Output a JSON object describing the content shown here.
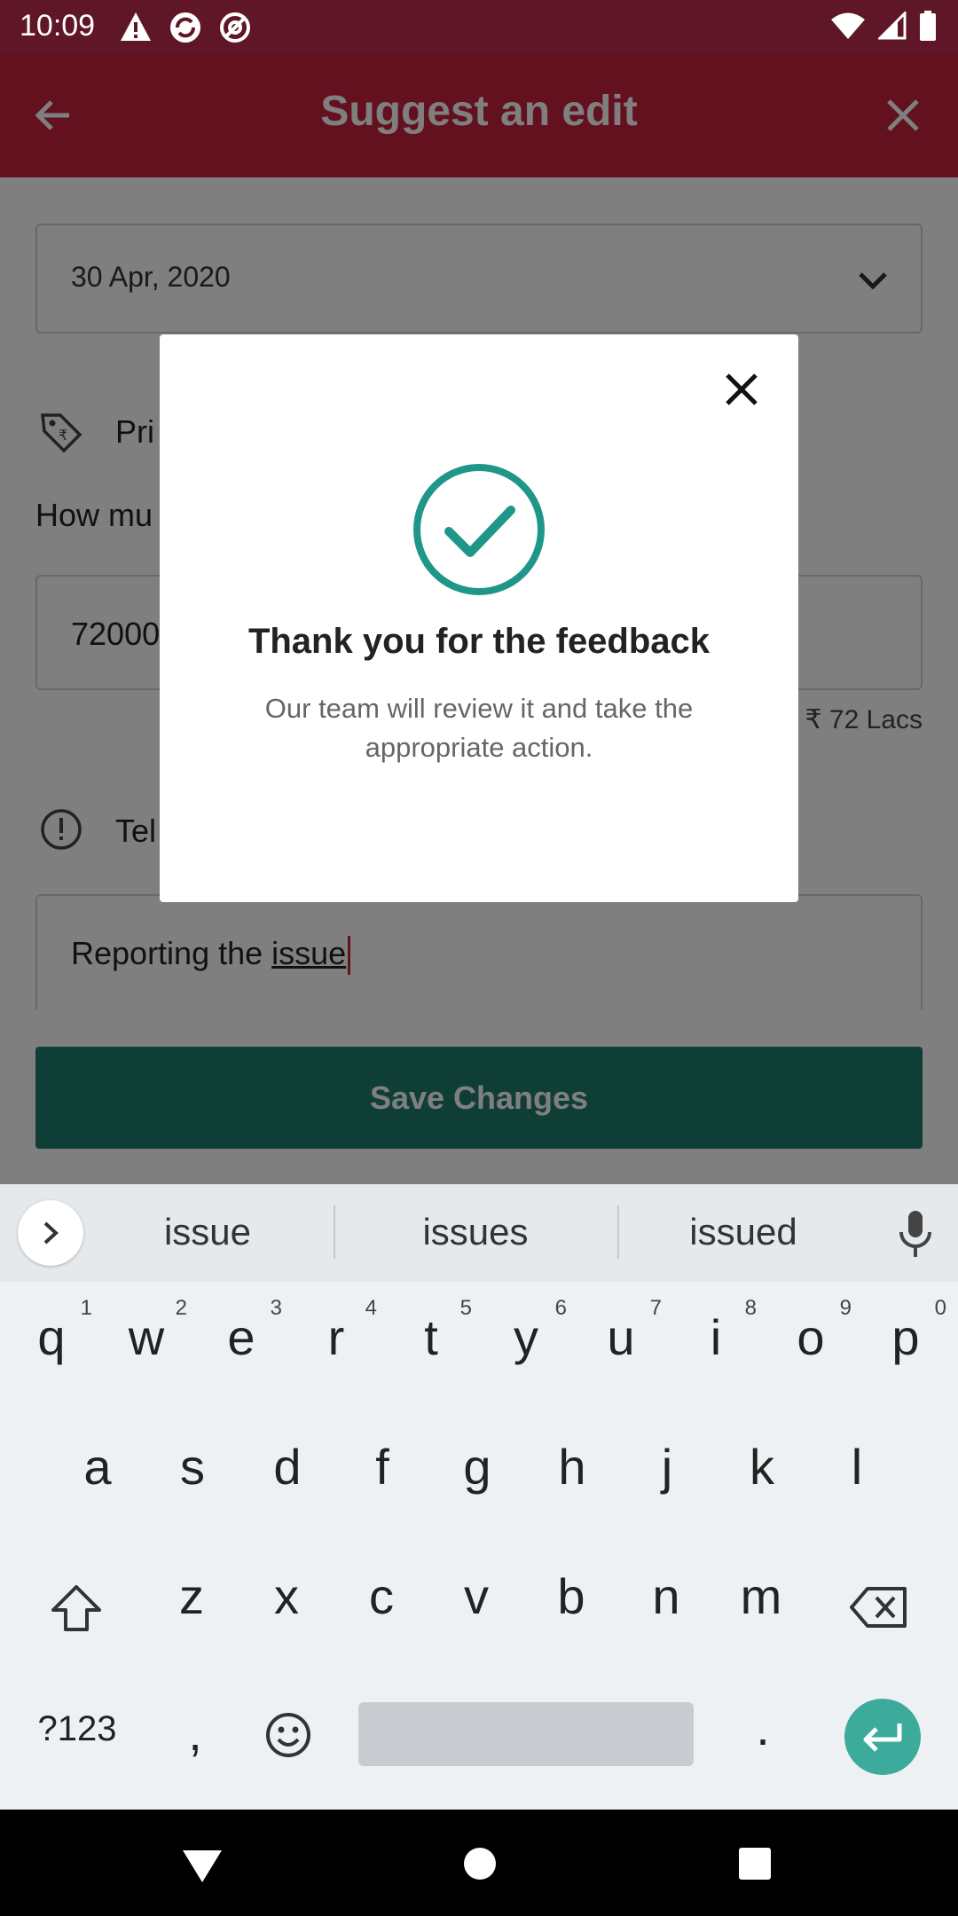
{
  "status_bar": {
    "time": "10:09"
  },
  "app_bar": {
    "title": "Suggest an edit"
  },
  "form": {
    "date_value": "30 Apr, 2020",
    "price_section_label": "Pri",
    "price_question": "How mu",
    "price_value": "72000",
    "price_in_words": "₹ 72  Lacs",
    "issue_section_label": "Tel",
    "issue_text_prefix": "Reporting the ",
    "issue_text_word": "issue",
    "save_button": "Save Changes"
  },
  "dialog": {
    "title": "Thank you for the feedback",
    "message": "Our team will review it and take the appropriate action."
  },
  "keyboard": {
    "suggestions": [
      "issue",
      "issues",
      "issued"
    ],
    "row1": [
      {
        "k": "q",
        "n": "1"
      },
      {
        "k": "w",
        "n": "2"
      },
      {
        "k": "e",
        "n": "3"
      },
      {
        "k": "r",
        "n": "4"
      },
      {
        "k": "t",
        "n": "5"
      },
      {
        "k": "y",
        "n": "6"
      },
      {
        "k": "u",
        "n": "7"
      },
      {
        "k": "i",
        "n": "8"
      },
      {
        "k": "o",
        "n": "9"
      },
      {
        "k": "p",
        "n": "0"
      }
    ],
    "row2": [
      "a",
      "s",
      "d",
      "f",
      "g",
      "h",
      "j",
      "k",
      "l"
    ],
    "row3": [
      "z",
      "x",
      "c",
      "v",
      "b",
      "n",
      "m"
    ],
    "symbols_key": "?123",
    "comma_key": ",",
    "period_key": "."
  },
  "colors": {
    "app_bar": "#c8233f",
    "status_bar": "#5f1627",
    "primary_button": "#1f7c6f",
    "accent_teal": "#1f968a"
  }
}
